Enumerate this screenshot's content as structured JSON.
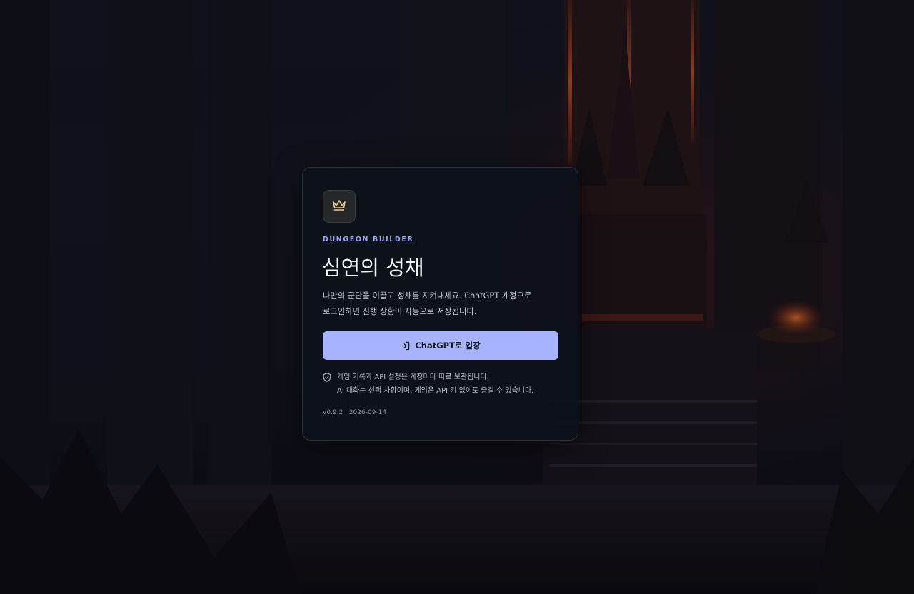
{
  "background": {
    "description_icon": "dark-castle-throne-room-background"
  },
  "card": {
    "logo_icon": "crown-icon",
    "eyebrow": "DUNGEON BUILDER",
    "title": "심연의 성채",
    "description_line1": "나만의 군단을 이끌고 성채를 지켜내세요. ChatGPT 계정으로",
    "description_line2": "로그인하면 진행 상황이 자동으로 저장됩니다.",
    "enter_button": {
      "icon": "login-icon",
      "label": "ChatGPT로 입장"
    },
    "notice": {
      "icon": "shield-check-icon",
      "line1": "게임 기록과 API 설정은 계정마다 따로 보관됩니다.",
      "line2": "AI 대화는 선택 사항이며, 게임은 API 키 없이도 즐길 수 있습니다."
    },
    "version": "v0.9.2 · 2026-09-14"
  },
  "colors": {
    "accent": "#a8b4ff",
    "eyebrow": "#9aa2ff",
    "crown": "#e9c98a",
    "card_bg": "#0d111b"
  }
}
